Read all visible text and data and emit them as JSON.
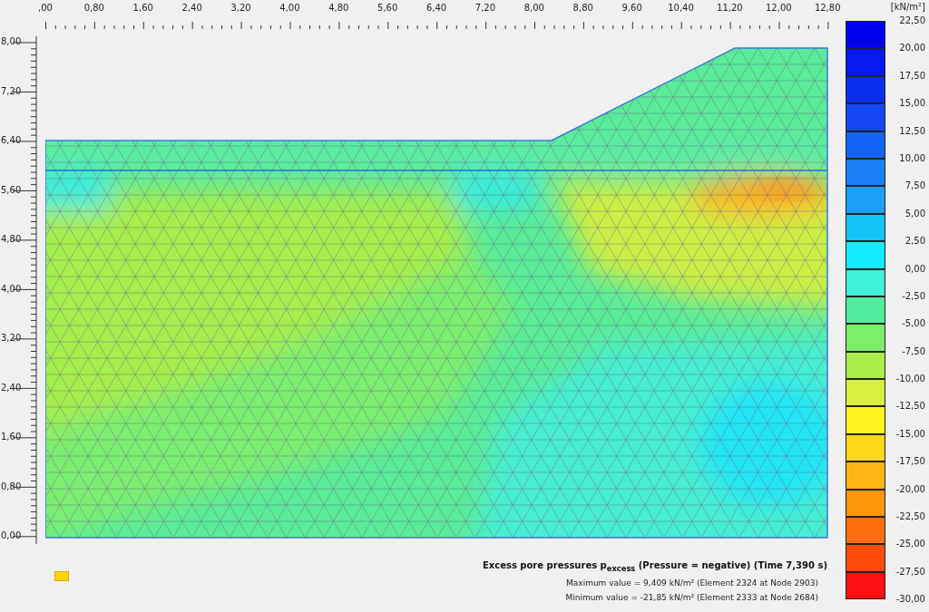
{
  "x_axis": {
    "labels": [
      ",00",
      "0,80",
      "1,60",
      "2,40",
      "3,20",
      "4,00",
      "4,80",
      "5,60",
      "6,40",
      "7,20",
      "8,00",
      "8,80",
      "9,60",
      "10,40",
      "11,20",
      "12,00",
      "12,80"
    ]
  },
  "y_axis": {
    "labels": [
      "8,00",
      "7,20",
      "6,40",
      "5,60",
      "4,80",
      "4,00",
      "3,20",
      "2,40",
      "1,60",
      "0,80",
      "0,00"
    ]
  },
  "legend": {
    "unit": "[kN/m²]",
    "swatches": [
      {
        "color": "#0000f0"
      },
      {
        "color": "#0818f0"
      },
      {
        "color": "#0a2ef0"
      },
      {
        "color": "#1448f5"
      },
      {
        "color": "#1464f5"
      },
      {
        "color": "#1a80f5"
      },
      {
        "color": "#1aa0f5"
      },
      {
        "color": "#14c4f5"
      },
      {
        "color": "#14ecff"
      },
      {
        "color": "#40f0d8"
      },
      {
        "color": "#50ee9c"
      },
      {
        "color": "#7cee68"
      },
      {
        "color": "#aaee4c"
      },
      {
        "color": "#d8f040"
      },
      {
        "color": "#fff420"
      },
      {
        "color": "#ffd818"
      },
      {
        "color": "#ffb414"
      },
      {
        "color": "#ff960e"
      },
      {
        "color": "#ff700c"
      },
      {
        "color": "#ff4c0a"
      },
      {
        "color": "#ff1010"
      }
    ],
    "labels": [
      "22,50",
      "20,00",
      "17,50",
      "15,00",
      "12,50",
      "10,00",
      "7,50",
      "5,00",
      "2,50",
      "0,00",
      "-2,50",
      "-5,00",
      "-7,50",
      "-10,00",
      "-12,50",
      "-15,00",
      "-17,50",
      "-20,00",
      "-22,50",
      "-25,00",
      "-27,50",
      "-30,00"
    ]
  },
  "caption": {
    "title": "Excess pore pressures p$_{excess}$ (Pressure = negative) (Time 7,390 s)",
    "lines": [
      "Maximum value = 9,409 kN/m² (Element 2324 at Node 2903)",
      "Minimum value = -21,85 kN/m² (Element 2333 at Node 2684)"
    ]
  }
}
